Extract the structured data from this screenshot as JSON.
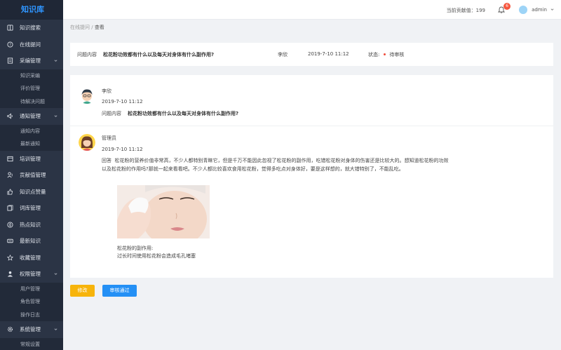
{
  "sidebar": {
    "logo": "知识库",
    "items": [
      {
        "label": "知识搜索",
        "icon": "book-icon"
      },
      {
        "label": "在线提问",
        "icon": "question-circle-icon"
      },
      {
        "label": "采编管理",
        "icon": "document-icon",
        "expanded": true,
        "children": [
          "知识采编",
          "评价管理",
          "待解决问题"
        ]
      },
      {
        "label": "通知管理",
        "icon": "speaker-icon",
        "expanded": true,
        "children": [
          "通知内容",
          "最新通知"
        ]
      },
      {
        "label": "培训管理",
        "icon": "training-icon"
      },
      {
        "label": "贡献值管理",
        "icon": "contribution-icon"
      },
      {
        "label": "知识点赞量",
        "icon": "thumbs-up-icon"
      },
      {
        "label": "词库管理",
        "icon": "lexicon-icon"
      },
      {
        "label": "热点知识",
        "icon": "hot-icon"
      },
      {
        "label": "最新知识",
        "icon": "new-icon"
      },
      {
        "label": "收藏管理",
        "icon": "star-icon"
      },
      {
        "label": "权限管理",
        "icon": "user-icon",
        "expanded": true,
        "children": [
          "用户管理",
          "角色管理",
          "操作日志"
        ]
      },
      {
        "label": "系统管理",
        "icon": "gear-icon",
        "expanded": true,
        "children": [
          "常规设置"
        ]
      }
    ]
  },
  "header": {
    "contribution_label": "当前贡献值：",
    "contribution_value": "199",
    "notification_count": "6",
    "username": "admin"
  },
  "breadcrumb": {
    "parent": "在线提问",
    "separator": " / ",
    "current": "查看"
  },
  "question_bar": {
    "label": "问题内容",
    "question": "松花粉功效都有什么以及每天对身体有什么副作用?",
    "asker": "李欣",
    "datetime": "2019-7-10 11:12",
    "status_label": "状态:",
    "status_value": "待审核",
    "status_color": "#f04a3a"
  },
  "thread": {
    "question_post": {
      "author": "李欣",
      "datetime": "2019-7-10 11:12",
      "label": "问题内容",
      "content": "松花粉功效都有什么以及每天对身体有什么副作用?"
    },
    "answer_post": {
      "author": "管理员",
      "datetime": "2019-7-10 11:12",
      "label": "回答",
      "content": "松花粉的营养价值非常高，不少人都特别青睐它，但是千万不能因此忽视了松花粉的副作用，吃错松花粉对身体的伤害还是比较大的。想知道松花粉的功效以及松花粉的作用吗?那就一起来看看吧。不少人都比较喜欢食用松花粉，觉得多吃点对身体好，要是这样想的，就大错特别了，不能乱吃。",
      "note_title": "松花粉的副作用:",
      "note_body": "过长时间使用松花粉会造成毛孔堵塞"
    }
  },
  "actions": {
    "edit": "修改",
    "approve": "审核通过"
  },
  "colors": {
    "sidebar_bg": "#2b3445",
    "logo": "#2f95ff",
    "edit_btn": "#f7b40b",
    "approve_btn": "#2490f5",
    "badge": "#f5563e"
  }
}
